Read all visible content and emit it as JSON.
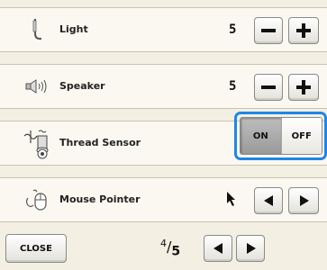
{
  "rows": [
    {
      "label": "Light",
      "value": "5",
      "icon": "light-icon"
    },
    {
      "label": "Speaker",
      "value": "5",
      "icon": "speaker-icon"
    },
    {
      "label": "Thread Sensor",
      "icon": "thread-sensor-icon",
      "toggle": {
        "on_label": "ON",
        "off_label": "OFF",
        "state": "on"
      }
    },
    {
      "label": "Mouse Pointer",
      "icon": "mouse-pointer-icon",
      "pointer_icon": "arrow-cursor-icon"
    }
  ],
  "controls": {
    "minus": "minus-icon",
    "plus": "plus-icon",
    "left": "left-arrow-icon",
    "right": "right-arrow-icon"
  },
  "footer": {
    "close_label": "CLOSE",
    "page_current": "4",
    "page_total": "5"
  },
  "colors": {
    "highlight": "#1f86e8",
    "background": "#f3efe3",
    "panel": "#faf8f0"
  }
}
